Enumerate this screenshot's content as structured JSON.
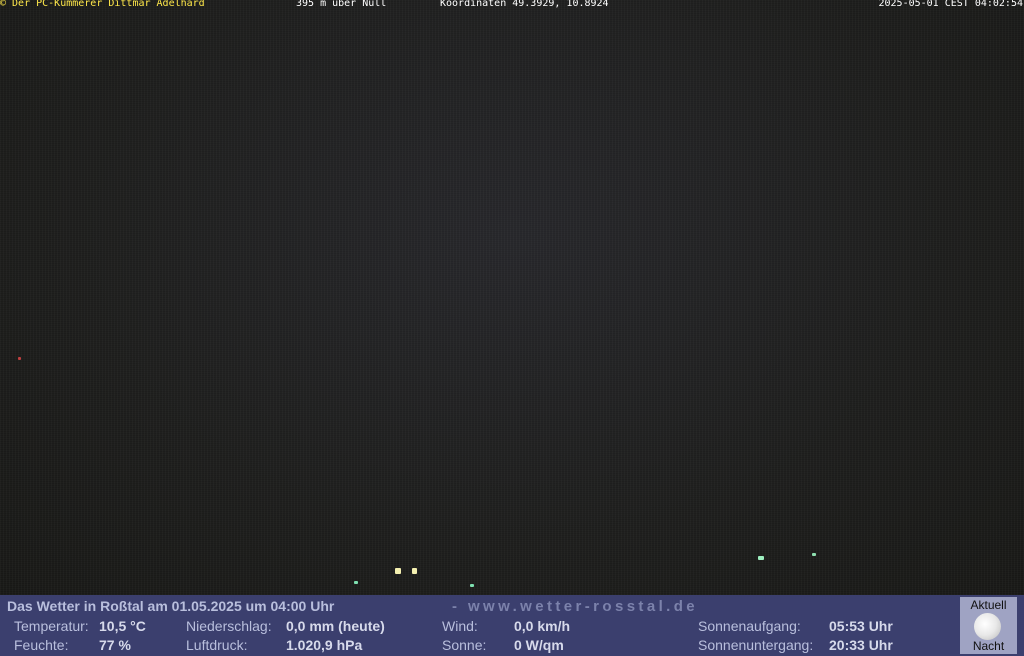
{
  "overlay": {
    "owner": "© Der PC-Kümmerer Dittmar Adelhard",
    "altitude": "395 m über Null",
    "coordinates": "Koordinaten 49.3929, 10.8924",
    "timestamp": "2025-05-01 CEST 04:02:54"
  },
  "weather": {
    "title": "Das Wetter in Roßtal am 01.05.2025 um 04:00 Uhr",
    "website": "- www.wetter-rosstal.de",
    "temperature_label": "Temperatur:",
    "temperature_value": "10,5 °C",
    "humidity_label": "Feuchte:",
    "humidity_value": "77 %",
    "precipitation_label": "Niederschlag:",
    "precipitation_value": "0,0 mm (heute)",
    "pressure_label": "Luftdruck:",
    "pressure_value": "1.020,9 hPa",
    "wind_label": "Wind:",
    "wind_value": "0,0 km/h",
    "sun_label": "Sonne:",
    "sun_value": "0 W/qm",
    "sunrise_label": "Sonnenaufgang:",
    "sunrise_value": "05:53 Uhr",
    "sunset_label": "Sonnenuntergang:",
    "sunset_value": "20:33 Uhr"
  },
  "moon": {
    "header": "Aktuell",
    "status": "Nacht",
    "icon": "full-moon-icon"
  },
  "colors": {
    "panel_bg": "#3b3f6e",
    "owner_text": "#ffe84a"
  }
}
